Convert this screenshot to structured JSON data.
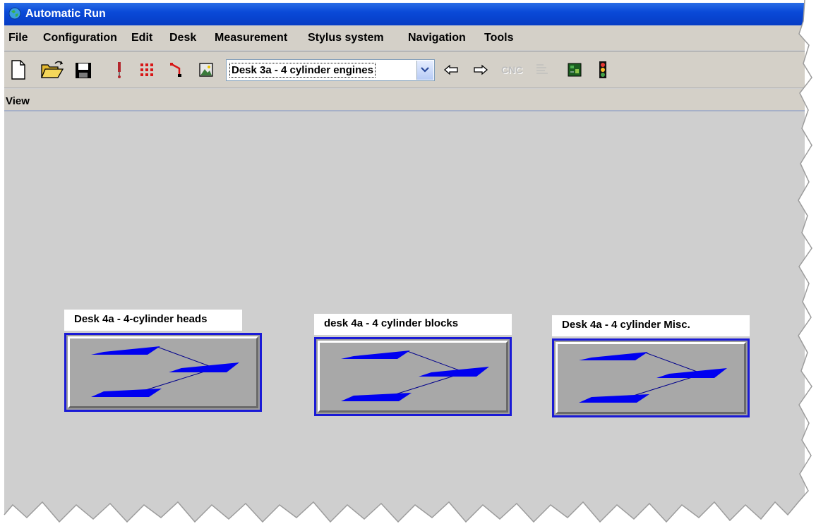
{
  "window": {
    "title": "Automatic Run"
  },
  "menu": {
    "items": [
      "File",
      "Configuration",
      "Edit",
      "Desk",
      "Measurement",
      "Stylus system",
      "Navigation",
      "Tools"
    ]
  },
  "toolbar": {
    "desk_selector": {
      "value": "Desk 3a - 4 cylinder engines"
    },
    "cnc_label": "CNC",
    "icons": [
      "new-file-icon",
      "open-folder-icon",
      "save-disk-icon",
      "stylus-icon",
      "grid-icon",
      "path-icon",
      "image-icon",
      "dropdown-arrow-icon",
      "back-arrow-icon",
      "forward-arrow-icon",
      "cnc-icon",
      "list-icon",
      "chip-icon",
      "traffic-light-icon"
    ]
  },
  "view": {
    "label": "View"
  },
  "desks": [
    {
      "label": "Desk 4a - 4-cylinder heads"
    },
    {
      "label": "desk 4a - 4 cylinder blocks"
    },
    {
      "label": "Desk 4a - 4 cylinder Misc."
    }
  ],
  "colors": {
    "title_bar": "#0a4ad8",
    "accent_border": "#1a1ad6",
    "desk_shape": "#0000f0",
    "background": "#cfcfcf"
  }
}
